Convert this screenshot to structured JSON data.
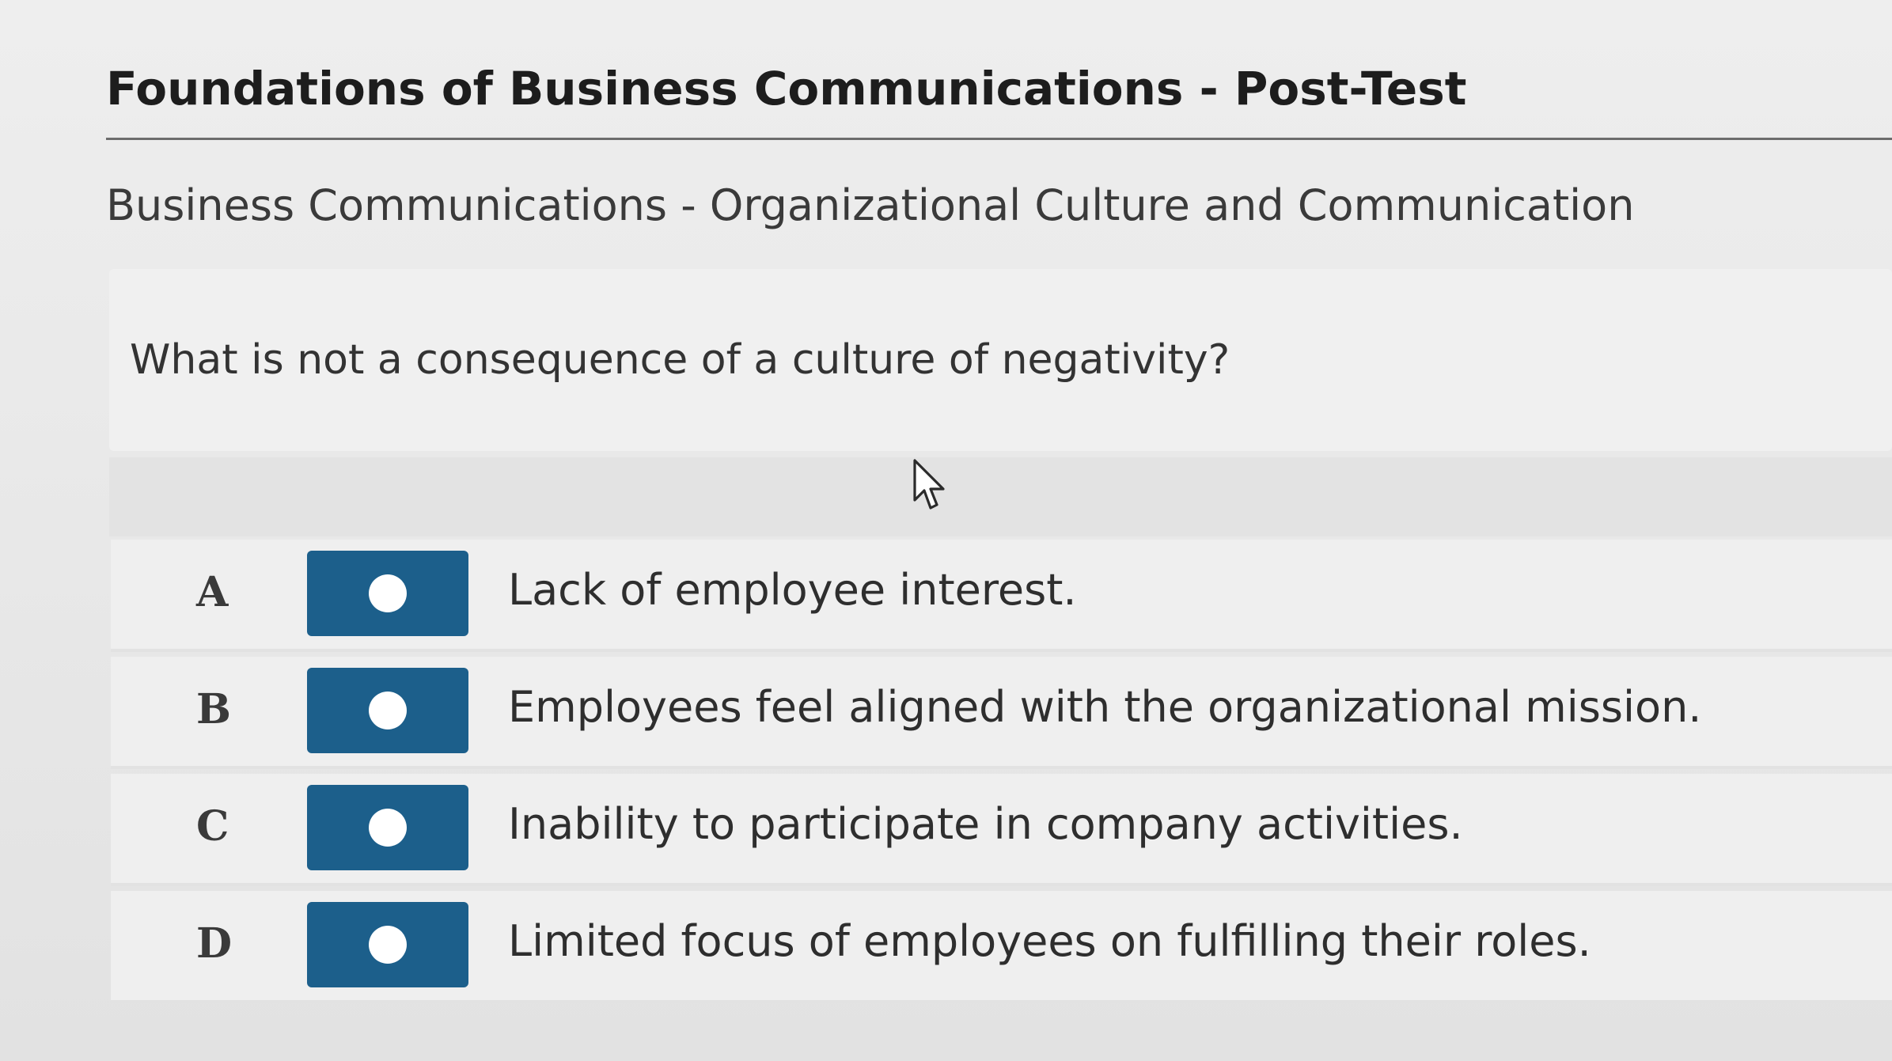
{
  "header": {
    "title": "Foundations of Business Communications - Post-Test",
    "subtitle": "Business Communications - Organizational Culture and Communication"
  },
  "question": {
    "text": "What is not a consequence of a culture of negativity?"
  },
  "options": [
    {
      "letter": "A",
      "text": "Lack of employee interest."
    },
    {
      "letter": "B",
      "text": "Employees feel aligned with the organizational mission."
    },
    {
      "letter": "C",
      "text": "Inability to participate in company activities."
    },
    {
      "letter": "D",
      "text": "Limited focus of employees on fulfilling their roles."
    }
  ],
  "colors": {
    "accent": "#1c5f8b",
    "background": "#eeeeee",
    "text": "#2a2a2a"
  },
  "icons": {
    "cursor": "mouse-pointer-icon",
    "radio": "radio-dot-icon"
  }
}
